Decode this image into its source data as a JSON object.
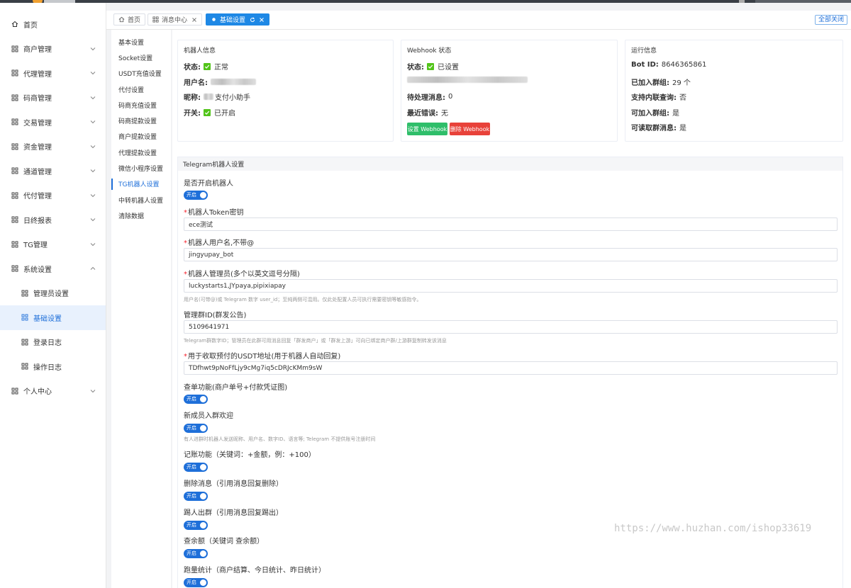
{
  "sidebar": {
    "items": [
      {
        "label": "首页",
        "icon": "home-icon",
        "chevron": false
      },
      {
        "label": "商户管理",
        "icon": "grid-icon",
        "chevron": "down"
      },
      {
        "label": "代理管理",
        "icon": "grid-icon",
        "chevron": "down"
      },
      {
        "label": "码商管理",
        "icon": "grid-icon",
        "chevron": "down"
      },
      {
        "label": "交易管理",
        "icon": "grid-icon",
        "chevron": "down"
      },
      {
        "label": "资金管理",
        "icon": "grid-icon",
        "chevron": "down"
      },
      {
        "label": "通道管理",
        "icon": "grid-icon",
        "chevron": "down"
      },
      {
        "label": "代付管理",
        "icon": "grid-icon",
        "chevron": "down"
      },
      {
        "label": "日终报表",
        "icon": "grid-icon",
        "chevron": "down"
      },
      {
        "label": "TG管理",
        "icon": "grid-icon",
        "chevron": "down"
      },
      {
        "label": "系统设置",
        "icon": "grid-icon",
        "chevron": "up"
      },
      {
        "label": "管理员设置",
        "icon": "grid-icon",
        "chevron": false,
        "sub": true
      },
      {
        "label": "基础设置",
        "icon": "grid-icon",
        "chevron": false,
        "sub": true,
        "active": true
      },
      {
        "label": "登录日志",
        "icon": "grid-icon",
        "chevron": false,
        "sub": true
      },
      {
        "label": "操作日志",
        "icon": "grid-icon",
        "chevron": false,
        "sub": true
      },
      {
        "label": "个人中心",
        "icon": "grid-icon",
        "chevron": "down"
      }
    ]
  },
  "tabs": {
    "home": "首页",
    "messages": "消息中心",
    "basic": "基础设置",
    "close_all": "全部关闭"
  },
  "submenu": {
    "items": [
      "基本设置",
      "Socket设置",
      "USDT充值设置",
      "代付设置",
      "码商充值设置",
      "码商提款设置",
      "商户提款设置",
      "代理提款设置",
      "微信小程序设置",
      "TG机器人设置",
      "中转机器人设置",
      "清除数据"
    ],
    "active_index": 9
  },
  "bot_info": {
    "title": "机器人信息",
    "status_label": "状态:",
    "status_value": "正常",
    "username_label": "用户名:",
    "nickname_label": "昵称:",
    "nickname_value": "支付小助手",
    "switch_label": "开关:",
    "switch_value": "已开启"
  },
  "webhook": {
    "title": "Webhook 状态",
    "status_label": "状态:",
    "status_value": "已设置",
    "pending_label": "待处理消息:",
    "pending_value": "0",
    "error_label": "最近错误:",
    "error_value": "无",
    "set_button": "设置 Webhook",
    "delete_button": "删除 Webhook",
    "set_color": "#2fbe6a",
    "delete_color": "#e8423a"
  },
  "run_info": {
    "title": "运行信息",
    "botid_label": "Bot ID:",
    "botid_value": "8646365861",
    "groups_label": "已加入群组:",
    "groups_value": "29 个",
    "inline_label": "支持内联查询:",
    "inline_value": "否",
    "can_join_label": "可加入群组:",
    "can_join_value": "是",
    "read_all_label": "可读取群消息:",
    "read_all_value": "是"
  },
  "form": {
    "section_title": "Telegram机器人设置",
    "enable_label": "是否开启机器人",
    "switch_on_text": "开启",
    "token_label": "机器人Token密钥",
    "token_value": "ece测试",
    "username_label": "机器人用户名,不带@",
    "username_value": "jingyupay_bot",
    "admins_label": "机器人管理员(多个以英文逗号分隔)",
    "admins_value": "luckystarts1,JYpaya,pipixiapay",
    "admins_hint": "用户名(可带@)或 Telegram 数字 user_id；至纯两侧可混用。仅此处配置人员可执行需要密钥等敏感指令。",
    "admin_group_label": "管理群ID(群发公告)",
    "admin_group_value": "5109641971",
    "admin_group_hint": "Telegram群数字ID；管理员在此群可用消息回复「群发商户」或「群发上游」可向已绑定商户群/上游群复制转发该消息",
    "usdt_label": "用于收取预付的USDT地址(用于机器人自动回复)",
    "usdt_value": "TDfhwt9pNoFfLjy9cMg7iq5cDRJcKMm9sW",
    "query_label": "查单功能(商户单号+付款凭证图)",
    "welcome_label": "新成员入群欢迎",
    "welcome_hint": "有人进群时机器人发送昵称、用户名、数字ID、语言等; Telegram 不提供账号注册时间",
    "accounting_label": "记账功能（关键词：+金额，例：+100）",
    "delete_msg_label": "删除消息（引用消息回复删除）",
    "kick_label": "踢人出群（引用消息回复踢出）",
    "balance_label": "查余额（关键词 查余额）",
    "stats_label": "跑量统计（商户结算、今日统计、昨日统计）"
  },
  "watermark": "https://www.huzhan.com/ishop33619"
}
